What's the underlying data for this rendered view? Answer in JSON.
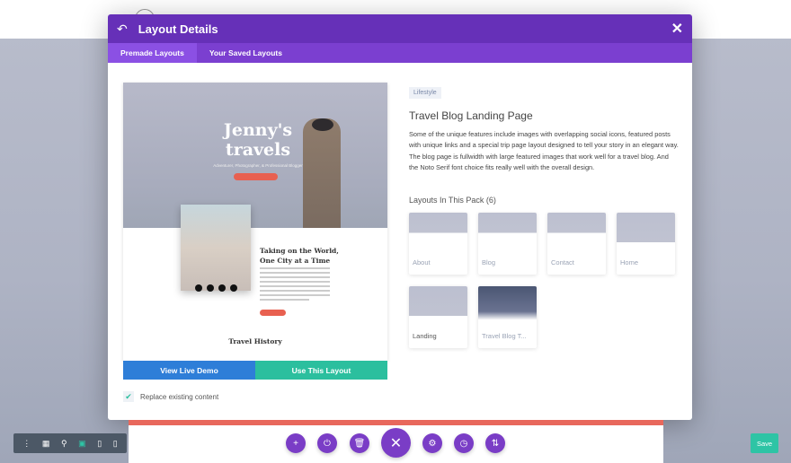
{
  "modal": {
    "title": "Layout Details",
    "tabs": [
      {
        "label": "Premade Layouts",
        "active": true
      },
      {
        "label": "Your Saved Layouts",
        "active": false
      }
    ]
  },
  "preview": {
    "hero_title": "Jenny's travels",
    "hero_subtitle": "Adventurer, Photographer, & Professional Blogger",
    "post_title": "Taking on the World, One City at a Time",
    "section_title": "Travel History"
  },
  "actions": {
    "view_demo": "View Live Demo",
    "use_layout": "Use This Layout",
    "replace_label": "Replace existing content",
    "replace_checked": true
  },
  "details": {
    "category": "Lifestyle",
    "title": "Travel Blog Landing Page",
    "description": "Some of the unique features include images with overlapping social icons, featured posts with unique links and a special trip page layout designed to tell your story in an elegant way. The blog page is fullwidth with large featured images that work well for a travel blog. And the Noto Serif font choice fits really well with the overall design.",
    "pack_heading": "Layouts In This Pack (6)",
    "layouts": [
      {
        "label": "About"
      },
      {
        "label": "Blog"
      },
      {
        "label": "Contact"
      },
      {
        "label": "Home"
      },
      {
        "label": "Landing"
      },
      {
        "label": "Travel Blog T..."
      }
    ]
  },
  "builder": {
    "save_label": "Save"
  },
  "colors": {
    "purple": "#6630b8",
    "tab": "#7b3fd0",
    "blue": "#2e7ed8",
    "green": "#2bbf9e",
    "red": "#e8685c"
  }
}
